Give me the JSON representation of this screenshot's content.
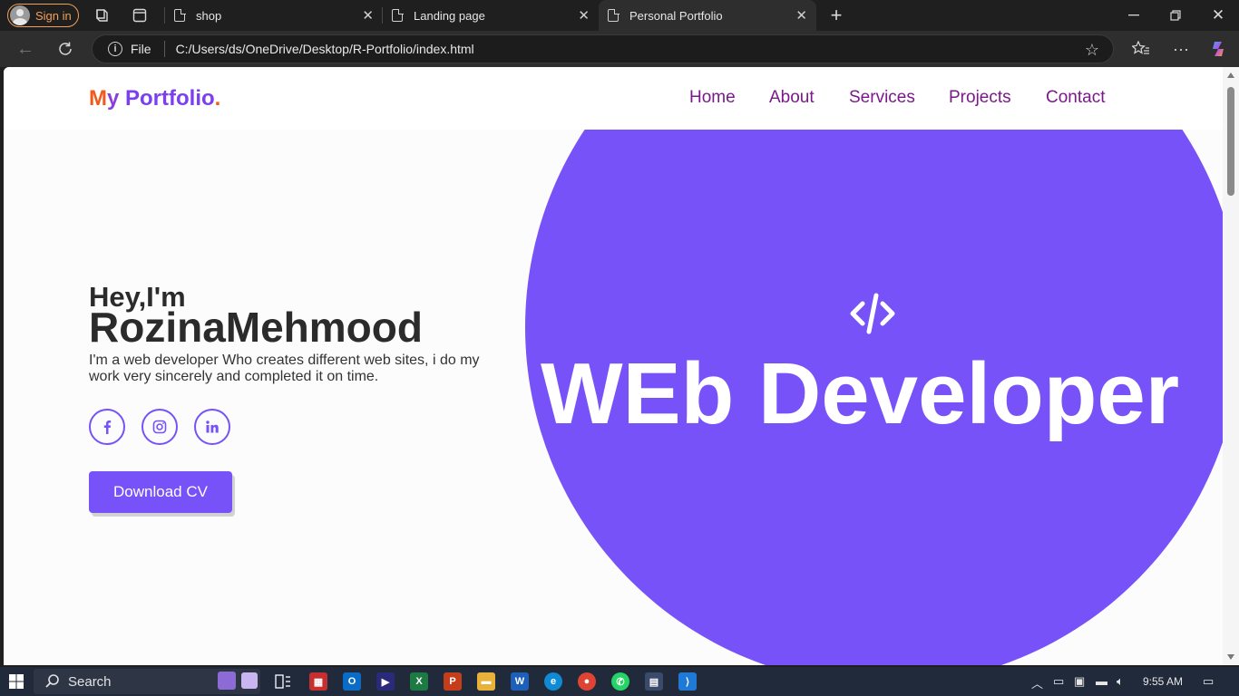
{
  "browser": {
    "signin_label": "Sign in",
    "tabs": [
      {
        "title": "shop"
      },
      {
        "title": "Landing page"
      },
      {
        "title": "Personal Portfolio"
      }
    ],
    "address": {
      "scheme_label": "File",
      "url": "C:/Users/ds/OneDrive/Desktop/R-Portfolio/index.html"
    }
  },
  "site": {
    "logo": {
      "part1": "M",
      "part2": "y ",
      "part3": "Portfolio",
      "dot": "."
    },
    "nav": [
      "Home",
      "About",
      "Services",
      "Projects",
      "Contact"
    ],
    "hero": {
      "greeting": "Hey,I'm",
      "name": "RozinaMehmood",
      "description": "I'm a web developer Who creates different web sites, i do my work very sincerely and completed it on time.",
      "cta": "Download CV",
      "big_title": "WEb Developer",
      "social": [
        "facebook-icon",
        "instagram-icon",
        "linkedin-icon"
      ]
    },
    "colors": {
      "accent": "#7652f8",
      "nav_text": "#7a1a8a",
      "logo_orange": "#ef5a1e"
    }
  },
  "taskbar": {
    "search_label": "Search",
    "time": "9:55 AM"
  }
}
